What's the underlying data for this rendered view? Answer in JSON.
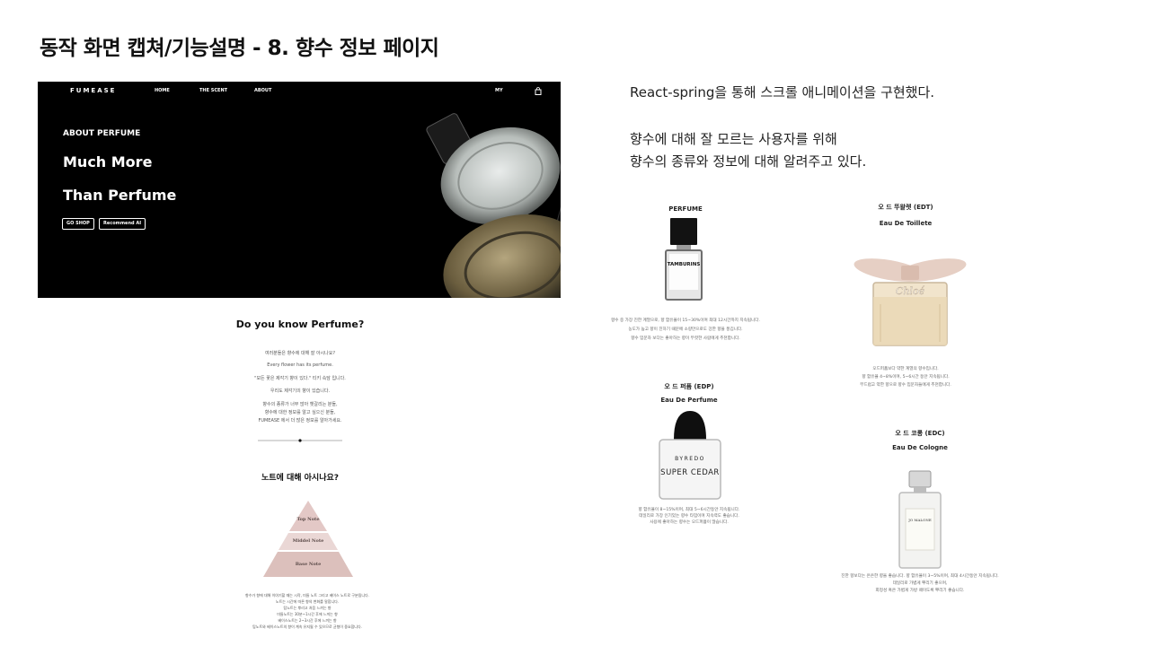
{
  "slide": {
    "title": "동작 화면 캡쳐/기능설명 - 8. 향수 정보 페이지",
    "description": [
      "React-spring을 통해 스크롤 애니메이션을 구현했다.",
      "향수에 대해 잘 모르는 사용자를 위해",
      "향수의 종류와 정보에 대해 알려주고 있다."
    ]
  },
  "hero": {
    "brand": "FUMEASE",
    "nav": [
      "HOME",
      "THE SCENT",
      "ABOUT"
    ],
    "nav_right": "MY",
    "subtitle": "ABOUT PERFUME",
    "headline_1": "Much More",
    "headline_2": "Than Perfume",
    "buttons": [
      "GO SHOP",
      "Recommend AI"
    ]
  },
  "intro": {
    "title": "Do you know Perfume?",
    "lines": [
      "여러분들은 향수에 대해 잘 아시나요?",
      "Every flower has its perfume.",
      "\"모든 꽃은 제각기 향이 있다.\" 티키 속담 입니다.",
      "우리도 제각기의 향이 있습니다.",
      "향수의 종류가 너무 많아 헷갈리는 분들,",
      "향수에 대한 정보를 알고 싶으신 분들,",
      "FUMEASE 에서 더 많은 정보를 알아가세요."
    ]
  },
  "notes": {
    "title": "노트에 대해 아시나요?",
    "levels": [
      "Top Note",
      "Middel Note",
      "Base Note"
    ],
    "lines": [
      "향수가 향에 대해 이야기할 때는 시작, 미들 노트 그리고 베이스 노트로 구분됩니다.",
      "노트는 시간에 따른 향의 변화를 말합니다.",
      "탑노트는 뿌리고 처음 느끼는 향",
      "미들노트는 30분~1시간 후에 느끼는 향",
      "베이스노트는 2~3시간 후에 느끼는 향",
      "탑노트와 베이스노트의 향이 계속 유지될 수 있으므로 균형이 중요합니다."
    ]
  },
  "types": [
    {
      "title": "PERFUME",
      "subtitle": "",
      "bottle": "TAMBURINS",
      "lines": [
        "향수 중 가장 진한 계열으로, 향 함유율이 15~30%이며 최대 12시간까지 지속됩니다.",
        "농도가 높고 향이 진하기 때문에 소량만으로도 강한 향을 풍깁니다.",
        "향수 입문자 보다는 좋아하는 향이 뚜렷한 사람에게 추천합니다."
      ]
    },
    {
      "title": "오 드 뚜왈렛 (EDT)",
      "subtitle": "Eau De Toillete",
      "bottle": "Chloé",
      "lines": [
        "오드퍼퓸보다 약한 계열의 향수입니다.",
        "향 함유율 4~8%이며, 5~6시간 동안 지속됩니다.",
        "부드럽고 약한 향으로 향수 입문자들에게 추천합니다."
      ]
    },
    {
      "title": "오 드 퍼퓸 (EDP)",
      "subtitle": "Eau De Perfume",
      "bottle": "SUPER CEDAR",
      "bottle_brand": "BYREDO",
      "lines": [
        "향 함유율이 8~15%이며, 최대 5~6시간동안 지속됩니다.",
        "데일리로 가장 인기있는 향수 타입이며 지속력도 좋습니다.",
        "사용에 좋아하는 향수는 오드퍼퓸이 많습니다."
      ]
    },
    {
      "title": "오 드 코롱 (EDC)",
      "subtitle": "Eau De Cologne",
      "bottle": "JO MALONE",
      "lines": [
        "진한 향보다는 은은한 향을 좋습니다. 향 함유율이 3~5%이며, 최대 4시간동안 지속됩니다.",
        "데일리로 가볍게 뿌리기 좋으며,",
        "회정성 혹은 가볍게 가방 떼이도록 뿌리기 좋습니다."
      ]
    }
  ],
  "colors": {
    "hero_bg": "#000000",
    "pyramid_top": "#e3c8c6",
    "pyramid_mid": "#ead7d5",
    "pyramid_base": "#dcc0bc"
  }
}
